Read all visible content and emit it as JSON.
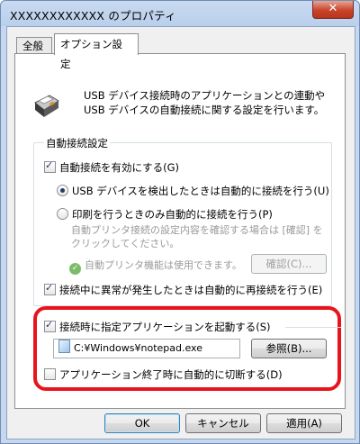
{
  "window": {
    "title": "XXXXXXXXXXXX のプロパティ",
    "close_label": "✕"
  },
  "tabs": [
    {
      "label": "全般",
      "selected": false
    },
    {
      "label": "オプション設定",
      "selected": true
    }
  ],
  "intro_text": "USB デバイス接続時のアプリケーションとの連動や USB デバイスの自動接続に関する設定を行います。",
  "auto_connect": {
    "group_title": "自動接続設定",
    "enable_label": "自動接続を有効にする(G)",
    "enable_checked": true,
    "radio_usb_label": "USB デバイスを検出したときは自動的に接続を行う(U)",
    "radio_usb_selected": true,
    "radio_print_label": "印刷を行うときのみ自動的に接続を行う(P)",
    "radio_print_selected": false,
    "print_note": "自動プリンタ接続の設定内容を確認する場合は [確認] をクリックしてください。",
    "printer_status": "自動プリンタ機能は使用できます。",
    "confirm_button": "確認(C)...",
    "reconnect_label": "接続中に異常が発生したときは自動的に再接続を行う(E)",
    "reconnect_checked": true
  },
  "app_launch": {
    "launch_label": "接続時に指定アプリケーションを起動する(S)",
    "launch_checked": true,
    "path_value": "C:¥Windows¥notepad.exe",
    "browse_button": "参照(B)...",
    "disconnect_label": "アプリケーション終了時に自動的に切断する(D)",
    "disconnect_checked": false
  },
  "footer": {
    "ok": "OK",
    "cancel": "キャンセル",
    "apply": "適用(A)"
  },
  "colors": {
    "highlight": "#e8131b",
    "titlebar": "#b9cfea",
    "close": "#c8432a"
  }
}
